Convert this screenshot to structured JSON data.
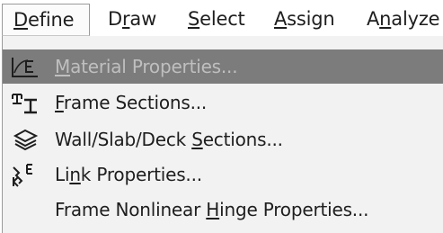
{
  "menubar": {
    "items": [
      {
        "pre": "",
        "key": "D",
        "post": "efine"
      },
      {
        "pre": "D",
        "key": "r",
        "post": "aw"
      },
      {
        "pre": "",
        "key": "S",
        "post": "elect"
      },
      {
        "pre": "",
        "key": "A",
        "post": "ssign"
      },
      {
        "pre": "A",
        "key": "n",
        "post": "alyze"
      }
    ]
  },
  "define_menu": {
    "items": [
      {
        "pre": "",
        "key": "M",
        "post": "aterial Properties...",
        "icon": "material-properties-icon",
        "highlighted": true
      },
      {
        "pre": "",
        "key": "F",
        "post": "rame Sections...",
        "icon": "frame-sections-icon",
        "highlighted": false
      },
      {
        "pre": "Wall/Slab/Deck ",
        "key": "S",
        "post": "ections...",
        "icon": "wall-slab-deck-icon",
        "highlighted": false
      },
      {
        "pre": "Li",
        "key": "n",
        "post": "k Properties...",
        "icon": "link-properties-icon",
        "highlighted": false
      },
      {
        "pre": "Frame Nonlinear ",
        "key": "H",
        "post": "inge Properties...",
        "icon": "",
        "highlighted": false
      }
    ]
  },
  "colors": {
    "highlight": "#7c7c7c",
    "menu_background": "#f2f2f2",
    "text": "#1e1e1e",
    "highlight_text": "#bfbfbf"
  }
}
